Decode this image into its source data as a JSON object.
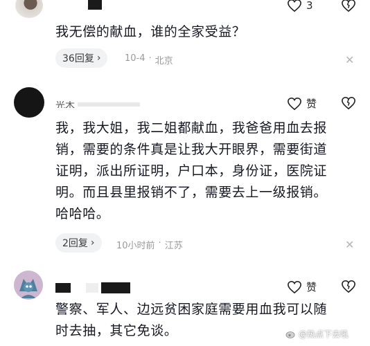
{
  "comments": [
    {
      "text": "我无偿的献血，谁的全家受益？",
      "like_count": "3",
      "reply_label": "36回复",
      "date": "10-4",
      "location": "北京"
    },
    {
      "username": "光木",
      "text_lines": [
        "我，我大姐，我二姐都献血，我爸爸用血去报",
        "销，需要的条件真是让我大开眼界，需要街道",
        "证明，派出所证明，户口本，身份证，医院证",
        "明。而且县里报销不了，需要去上一级报销。",
        "哈哈哈。"
      ],
      "like_label": "赞",
      "reply_label": "2回复",
      "date": "10小时前",
      "location": "江苏"
    },
    {
      "text_lines": [
        "警察、军人、边远贫困家庭需要用血我可以随",
        "时去抽，其它免谈。"
      ],
      "like_label": "赞"
    }
  ],
  "separator": "·",
  "watermark": "@热点下去吼",
  "icons": {
    "like": "heart-icon",
    "dislike": "broken-heart-icon",
    "expand": "chevron-right-icon",
    "close": "close-icon",
    "watermark_logo": "weibo-logo-icon"
  }
}
